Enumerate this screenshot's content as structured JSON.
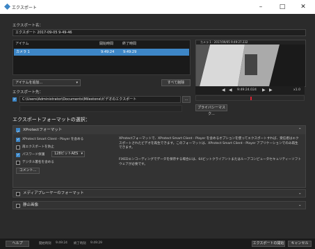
{
  "window": {
    "title": "エクスポート",
    "minimize": "–",
    "maximize": "□",
    "close": "✕"
  },
  "export_name": {
    "label": "エクスポート名：",
    "value": "エクスポート 2017-09-05 9-49-46"
  },
  "items_table": {
    "headers": [
      "アイテム",
      "開始時間",
      "終了時間"
    ],
    "rows": [
      {
        "item": "カメラ 1",
        "start": "9:49:24",
        "end": "9:49:29"
      }
    ]
  },
  "add_item_dropdown": "アイテムを追加...",
  "clear_all_button": "すべて削除",
  "export_dest": {
    "label": "エクスポート先：",
    "path": "C:\\Users\\Administrator\\Documents\\Milestone\\ビデオのエクスポート",
    "browse": "..."
  },
  "preview": {
    "title": "カメラ 1 - 2017/09/05 9:49:27.232",
    "time": "9:49:24.024",
    "speed": "x1.0",
    "privacy_mask_button": "プライバシーマスク..."
  },
  "format_section_title": "エクスポートフォーマットの選択：",
  "xprotect_format": {
    "title": "XProtectフォーマット",
    "options": [
      {
        "label": "XProtect Smart Client - Player を含める",
        "checked": true
      },
      {
        "label": "再エクスポートを防止",
        "checked": false
      },
      {
        "label": "パスワード保護",
        "checked": true
      },
      {
        "label": "デジタル署名を含める",
        "checked": false
      }
    ],
    "encryption": "128ビットAES",
    "comment_button": "コメント...",
    "description1": "XProtectフォーマットで、XProtect Smart Client - Player を含めるオプションを使ってエクスポートすれば、受信者はエクスポートされたビデオを再生できます。このフォーマットは、XProtect Smart Client - Player アプリケーションでのみ再生できます。",
    "description2": "FIXEDエンコーディングでデータを保存する場合には、64ビットクライアントまたはルーアコンピュータセキュリティーソフトウェアが必要です。"
  },
  "media_player_format": {
    "title": "メディアプレーヤーのフォーマット"
  },
  "still_images": {
    "title": "静止画像"
  },
  "bottom": {
    "help_button": "ヘルプ",
    "info": [
      "開始時刻",
      "9:49:24",
      "終了時刻",
      "9:49:29"
    ],
    "export_button": "エクスポートの開始",
    "cancel_button": "キャンセル"
  }
}
